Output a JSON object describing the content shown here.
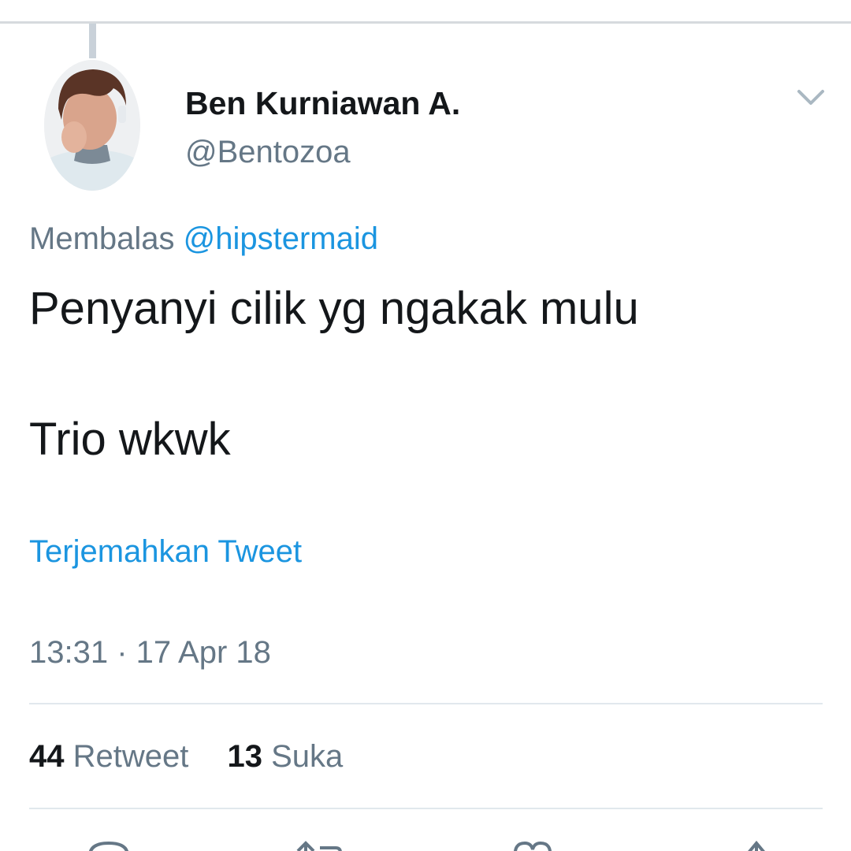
{
  "tweet": {
    "author": {
      "display_name": "Ben Kurniawan A.",
      "handle": "@Bentozoa"
    },
    "reply_prefix": "Membalas",
    "reply_mention": "@hipstermaid",
    "text_lines": [
      "Penyanyi cilik yg ngakak mulu",
      "Trio wkwk"
    ],
    "translate_label": "Terjemahkan Tweet",
    "timestamp": "13:31 · 17 Apr 18",
    "stats": {
      "retweet_count": "44",
      "retweet_label": "Retweet",
      "like_count": "13",
      "like_label": "Suka"
    }
  },
  "icons": {
    "menu": "chevron-down-icon",
    "reply": "reply-icon",
    "retweet": "retweet-icon",
    "like": "heart-icon",
    "share": "share-icon"
  },
  "colors": {
    "link": "#1b95e0",
    "secondary_text": "#657786",
    "primary_text": "#14171a",
    "divider": "#e1e8ed"
  }
}
